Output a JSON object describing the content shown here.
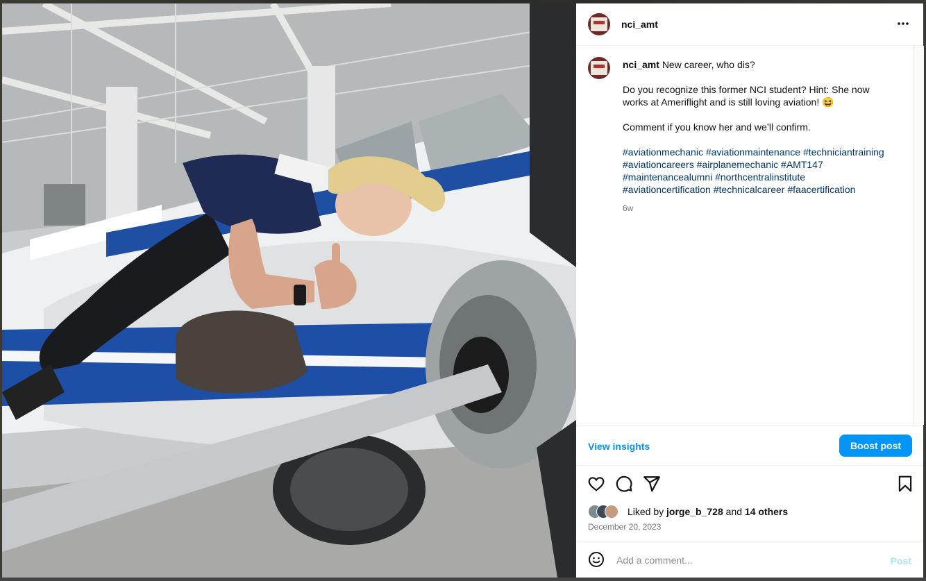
{
  "post": {
    "username": "nci_amt",
    "more_icon": "more-horizontal-icon",
    "caption": {
      "username": "nci_amt",
      "line1": "New career, who dis?",
      "line2": "Do you recognize this former NCI student? Hint: She now works at Ameriflight and is still loving aviation! 😆",
      "line3": "Comment if you know her and we’ll confirm.",
      "hashtags": [
        "#aviationmechanic",
        "#aviationmaintenance",
        "#techniciantraining",
        "#aviationcareers",
        "#airplanemechanic",
        "#AMT147",
        "#maintenancealumni",
        "#northcentralinstitute",
        "#aviationcertification",
        "#technicalcareer",
        "#faacertification"
      ]
    },
    "age": "6w",
    "view_insights": "View insights",
    "boost_label": "Boost post",
    "likes": {
      "prefix": "Liked by",
      "first_user": "jorge_b_728",
      "and": "and",
      "others": "14 others"
    },
    "date": "December 20, 2023",
    "comment_placeholder": "Add a comment...",
    "post_label": "Post"
  },
  "colors": {
    "accent": "#0095f6",
    "hashtag": "#00376b",
    "muted": "#737373",
    "post_disabled": "#b2dffc"
  }
}
